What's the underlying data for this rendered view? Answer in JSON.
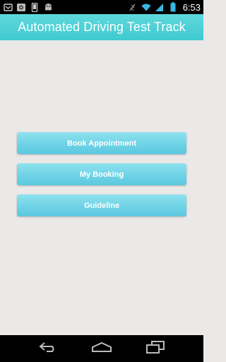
{
  "status_bar": {
    "time": "6:53",
    "left_icons": [
      "notification-icon",
      "image-icon",
      "phone-icon",
      "android-icon"
    ],
    "right_icons": [
      "signal-off-icon",
      "wifi-icon",
      "cellular-icon",
      "battery-icon"
    ]
  },
  "header": {
    "title": "Automated Driving Test Track",
    "background_color": "#4fd0d5"
  },
  "menu": {
    "items": [
      {
        "label": "Book Appointment"
      },
      {
        "label": "My Booking"
      },
      {
        "label": "Guideline"
      }
    ],
    "button_color": "#6fd3e6"
  },
  "nav_bar": {
    "buttons": [
      "back-icon",
      "home-icon",
      "recent-apps-icon"
    ]
  }
}
